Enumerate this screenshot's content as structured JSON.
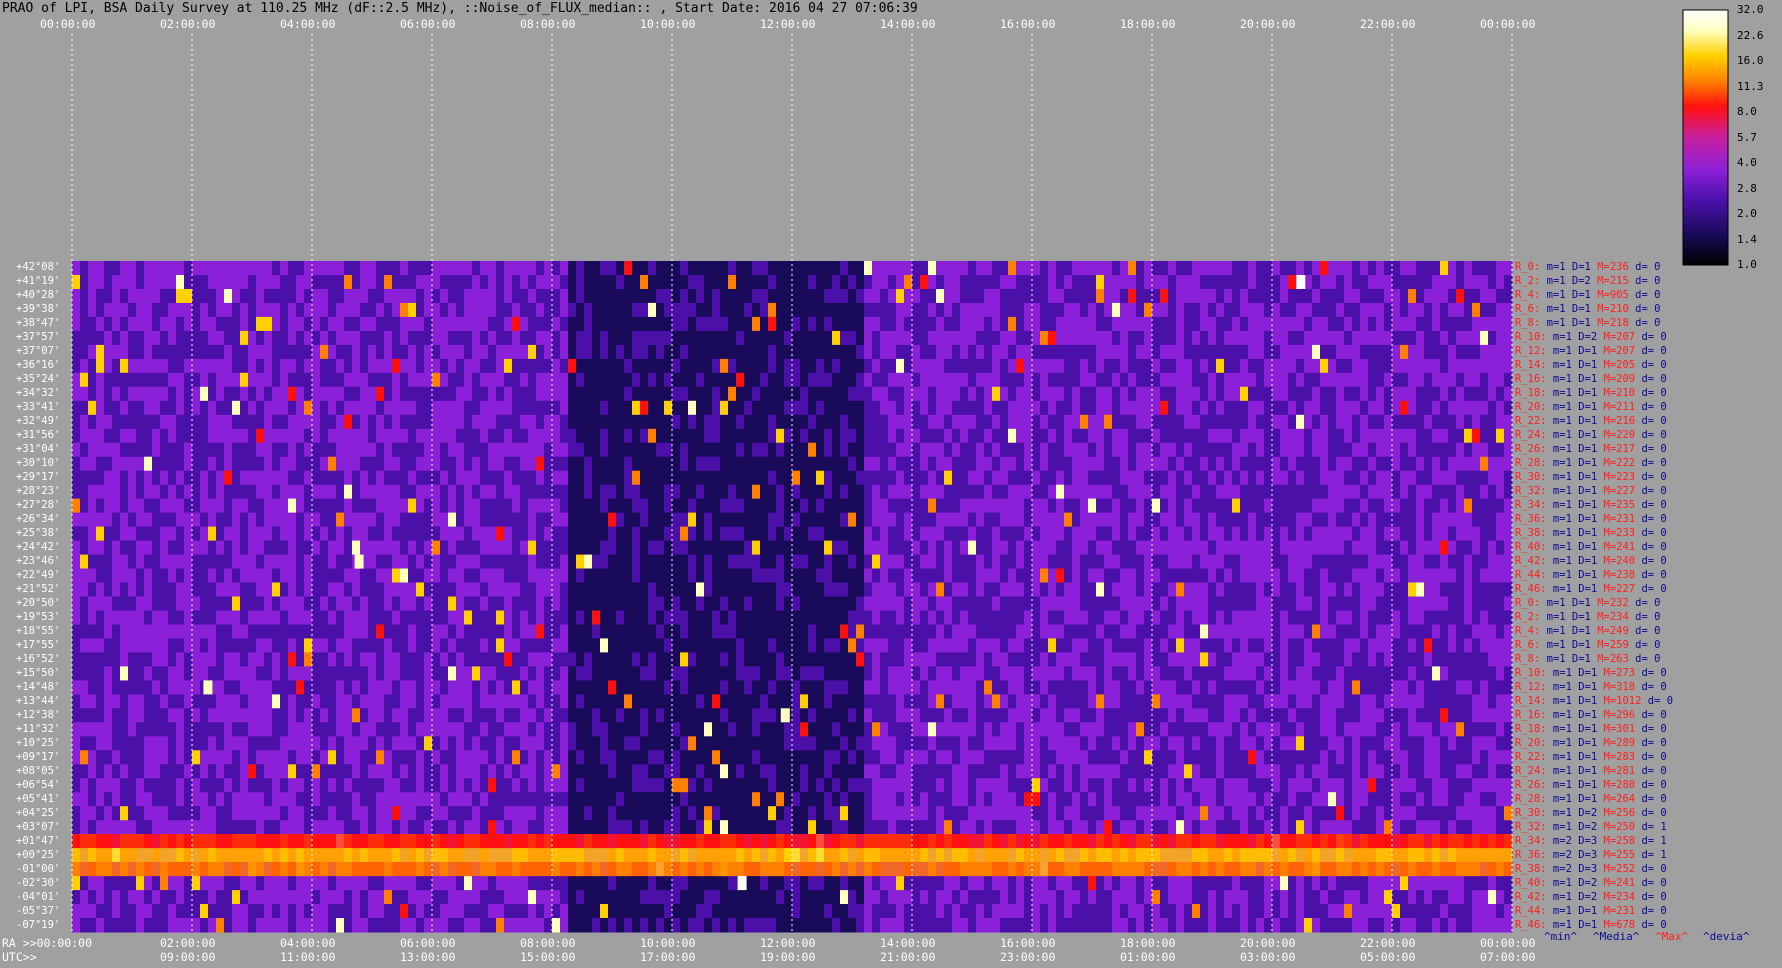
{
  "title": "PRAO of LPI, BSA Daily Survey at 110.25 MHz (dF::2.5 MHz), ::Noise_of_FLUX_median:: , Start Date: 2016 04 27 07:06:39",
  "chart_data": {
    "type": "heatmap",
    "title": "PRAO of LPI, BSA Daily Survey at 110.25 MHz (dF::2.5 MHz), ::Noise_of_FLUX_median:: , Start Date: 2016 04 27 07:06:39",
    "x_ra_ticks": [
      "00:00:00",
      "02:00:00",
      "04:00:00",
      "06:00:00",
      "08:00:00",
      "10:00:00",
      "12:00:00",
      "14:00:00",
      "16:00:00",
      "18:00:00",
      "20:00:00",
      "22:00:00",
      "00:00:00"
    ],
    "x_utc_ticks": [
      "09:00:00",
      "11:00:00",
      "13:00:00",
      "15:00:00",
      "17:00:00",
      "19:00:00",
      "21:00:00",
      "23:00:00",
      "01:00:00",
      "03:00:00",
      "05:00:00",
      "07:00:00"
    ],
    "x_ra_label": "RA >>00:00:00",
    "x_utc_label": "UTC>>",
    "dec_labels": [
      "+42°08'",
      "+41°19'",
      "+40°28'",
      "+39°38'",
      "+38°47'",
      "+37°57'",
      "+37°07'",
      "+36°16'",
      "+35°24'",
      "+34°32'",
      "+33°41'",
      "+32°49'",
      "+31°56'",
      "+31°04'",
      "+30°10'",
      "+29°17'",
      "+28°23'",
      "+27°28'",
      "+26°34'",
      "+25°38'",
      "+24°42'",
      "+23°46'",
      "+22°49'",
      "+21°52'",
      "+20°50'",
      "+19°53'",
      "+18°55'",
      "+17°55'",
      "+16°52'",
      "+15°50'",
      "+14°48'",
      "+13°44'",
      "+12°38'",
      "+11°32'",
      "+10°25'",
      "+09°17'",
      "+08°05'",
      "+06°54'",
      "+05°41'",
      "+04°25'",
      "+03°07'",
      "+01°47'",
      "+00°25'",
      "-01°00'",
      "-02°30'",
      "-04°01'",
      "-05°37'",
      "-07°19'"
    ],
    "colorbar": {
      "ticks": [
        "32.0",
        "22.6",
        "16.0",
        "11.3",
        "8.0",
        "5.7",
        "4.0",
        "2.8",
        "2.0",
        "1.4",
        "1.0"
      ],
      "scale": "log"
    },
    "beam_stats": [
      {
        "r": "R_0:",
        "m": "1",
        "D": "1",
        "M": "236",
        "d": "0"
      },
      {
        "r": "R_2:",
        "m": "1",
        "D": "2",
        "M": "215",
        "d": "0"
      },
      {
        "r": "R_4:",
        "m": "1",
        "D": "1",
        "M": "905",
        "d": "0"
      },
      {
        "r": "R_6:",
        "m": "1",
        "D": "1",
        "M": "210",
        "d": "0"
      },
      {
        "r": "R_8:",
        "m": "1",
        "D": "1",
        "M": "218",
        "d": "0"
      },
      {
        "r": "R_10:",
        "m": "1",
        "D": "2",
        "M": "207",
        "d": "0"
      },
      {
        "r": "R_12:",
        "m": "1",
        "D": "1",
        "M": "207",
        "d": "0"
      },
      {
        "r": "R_14:",
        "m": "1",
        "D": "1",
        "M": "205",
        "d": "0"
      },
      {
        "r": "R_16:",
        "m": "1",
        "D": "1",
        "M": "209",
        "d": "0"
      },
      {
        "r": "R_18:",
        "m": "1",
        "D": "1",
        "M": "210",
        "d": "0"
      },
      {
        "r": "R_20:",
        "m": "1",
        "D": "1",
        "M": "211",
        "d": "0"
      },
      {
        "r": "R_22:",
        "m": "1",
        "D": "1",
        "M": "216",
        "d": "0"
      },
      {
        "r": "R_24:",
        "m": "1",
        "D": "1",
        "M": "220",
        "d": "0"
      },
      {
        "r": "R_26:",
        "m": "1",
        "D": "1",
        "M": "217",
        "d": "0"
      },
      {
        "r": "R_28:",
        "m": "1",
        "D": "1",
        "M": "222",
        "d": "0"
      },
      {
        "r": "R_30:",
        "m": "1",
        "D": "1",
        "M": "223",
        "d": "0"
      },
      {
        "r": "R_32:",
        "m": "1",
        "D": "1",
        "M": "227",
        "d": "0"
      },
      {
        "r": "R_34:",
        "m": "1",
        "D": "1",
        "M": "235",
        "d": "0"
      },
      {
        "r": "R_36:",
        "m": "1",
        "D": "1",
        "M": "231",
        "d": "0"
      },
      {
        "r": "R_38:",
        "m": "1",
        "D": "1",
        "M": "233",
        "d": "0"
      },
      {
        "r": "R_40:",
        "m": "1",
        "D": "1",
        "M": "241",
        "d": "0"
      },
      {
        "r": "R_42:",
        "m": "1",
        "D": "1",
        "M": "240",
        "d": "0"
      },
      {
        "r": "R_44:",
        "m": "1",
        "D": "1",
        "M": "238",
        "d": "0"
      },
      {
        "r": "R_46:",
        "m": "1",
        "D": "1",
        "M": "227",
        "d": "0"
      },
      {
        "r": "R_0:",
        "m": "1",
        "D": "1",
        "M": "232",
        "d": "0"
      },
      {
        "r": "R_2:",
        "m": "1",
        "D": "1",
        "M": "234",
        "d": "0"
      },
      {
        "r": "R_4:",
        "m": "1",
        "D": "1",
        "M": "249",
        "d": "0"
      },
      {
        "r": "R_6:",
        "m": "1",
        "D": "1",
        "M": "259",
        "d": "0"
      },
      {
        "r": "R_8:",
        "m": "1",
        "D": "1",
        "M": "263",
        "d": "0"
      },
      {
        "r": "R_10:",
        "m": "1",
        "D": "1",
        "M": "273",
        "d": "0"
      },
      {
        "r": "R_12:",
        "m": "1",
        "D": "1",
        "M": "318",
        "d": "0"
      },
      {
        "r": "R_14:",
        "m": "1",
        "D": "1",
        "M": "1012",
        "d": "0"
      },
      {
        "r": "R_16:",
        "m": "1",
        "D": "1",
        "M": "296",
        "d": "0"
      },
      {
        "r": "R_18:",
        "m": "1",
        "D": "1",
        "M": "301",
        "d": "0"
      },
      {
        "r": "R_20:",
        "m": "1",
        "D": "1",
        "M": "289",
        "d": "0"
      },
      {
        "r": "R_22:",
        "m": "1",
        "D": "1",
        "M": "283",
        "d": "0"
      },
      {
        "r": "R_24:",
        "m": "1",
        "D": "1",
        "M": "281",
        "d": "0"
      },
      {
        "r": "R_26:",
        "m": "1",
        "D": "1",
        "M": "280",
        "d": "0"
      },
      {
        "r": "R_28:",
        "m": "1",
        "D": "1",
        "M": "264",
        "d": "0"
      },
      {
        "r": "R_30:",
        "m": "1",
        "D": "2",
        "M": "256",
        "d": "0"
      },
      {
        "r": "R_32:",
        "m": "1",
        "D": "2",
        "M": "250",
        "d": "1"
      },
      {
        "r": "R_34:",
        "m": "2",
        "D": "3",
        "M": "258",
        "d": "1"
      },
      {
        "r": "R_36:",
        "m": "2",
        "D": "3",
        "M": "255",
        "d": "1"
      },
      {
        "r": "R_38:",
        "m": "2",
        "D": "3",
        "M": "252",
        "d": "0"
      },
      {
        "r": "R_40:",
        "m": "1",
        "D": "2",
        "M": "241",
        "d": "0"
      },
      {
        "r": "R_42:",
        "m": "1",
        "D": "2",
        "M": "234",
        "d": "0"
      },
      {
        "r": "R_44:",
        "m": "1",
        "D": "1",
        "M": "231",
        "d": "0"
      },
      {
        "r": "R_46:",
        "m": "1",
        "D": "1",
        "M": "678",
        "d": "0"
      }
    ],
    "stats_legend": [
      "^min^",
      "^Media^",
      "^Max^",
      "^devia^"
    ],
    "colors": {
      "background": "#a0a0a0",
      "grid": "#ffffff",
      "axis_text": "#ffffff",
      "beam_label": "#ff2020",
      "stats_text": "#0a0a90",
      "colormap": [
        "#000000",
        "#1a0a5a",
        "#4a10a8",
        "#8a20d8",
        "#c820a0",
        "#ff1010",
        "#ff8000",
        "#ffd000",
        "#ffffc0",
        "#ffffff"
      ]
    }
  }
}
